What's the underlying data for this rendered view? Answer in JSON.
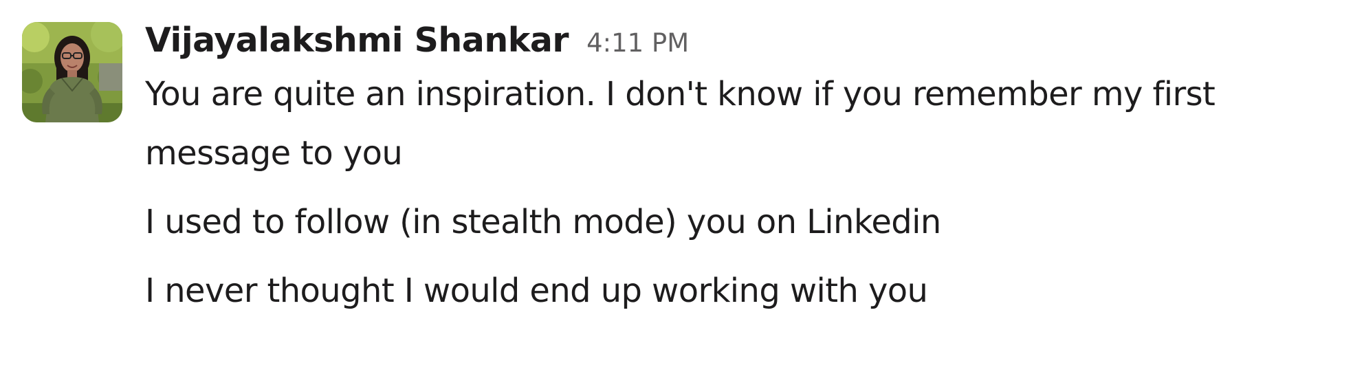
{
  "message": {
    "sender": "Vijayalakshmi Shankar",
    "timestamp": "4:11 PM",
    "avatar_icon": "user-photo-avatar",
    "lines": [
      "You are quite an inspiration. I don't know if you remember my first message to you",
      "I used to follow (in stealth mode) you on Linkedin",
      "I never thought I would end up working with you"
    ]
  },
  "colors": {
    "text": "#1d1c1d",
    "timestamp": "#616061",
    "background": "#ffffff"
  }
}
